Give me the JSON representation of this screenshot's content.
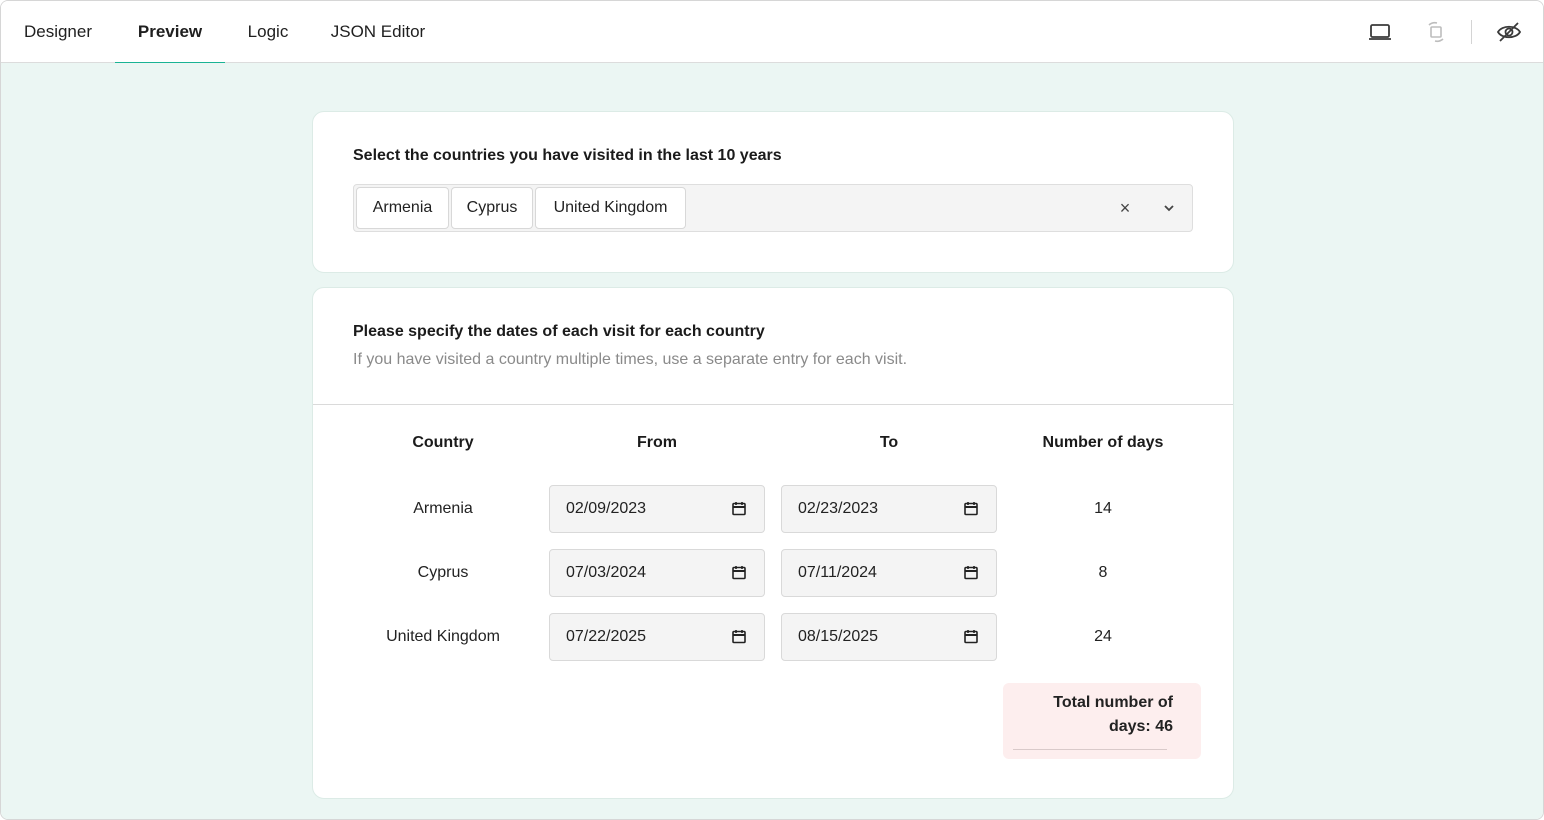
{
  "tabs": [
    {
      "label": "Designer",
      "active": false
    },
    {
      "label": "Preview",
      "active": true
    },
    {
      "label": "Logic",
      "active": false
    },
    {
      "label": "JSON Editor",
      "active": false
    }
  ],
  "toolbar": {
    "icons": [
      "laptop-device-icon",
      "rotate-orientation-icon",
      "eye-off-icon"
    ]
  },
  "colors": {
    "accent": "#19b394",
    "canvas_bg": "#ebf6f3",
    "total_bg": "#fdeeee"
  },
  "countries_question": {
    "title": "Select the countries you have visited in the last 10 years",
    "selected": [
      "Armenia",
      "Cyprus",
      "United Kingdom"
    ],
    "clear_symbol": "×"
  },
  "visits_question": {
    "title": "Please specify the dates of each visit for each country",
    "description": "If you have visited a country multiple times, use a separate entry for each visit.",
    "columns": [
      "Country",
      "From",
      "To",
      "Number of days"
    ],
    "rows": [
      {
        "country": "Armenia",
        "from": "02/09/2023",
        "to": "02/23/2023",
        "days": "14"
      },
      {
        "country": "Cyprus",
        "from": "07/03/2024",
        "to": "07/11/2024",
        "days": "8"
      },
      {
        "country": "United Kingdom",
        "from": "07/22/2025",
        "to": "08/15/2025",
        "days": "24"
      }
    ],
    "total_label": "Total number of days: 46"
  }
}
